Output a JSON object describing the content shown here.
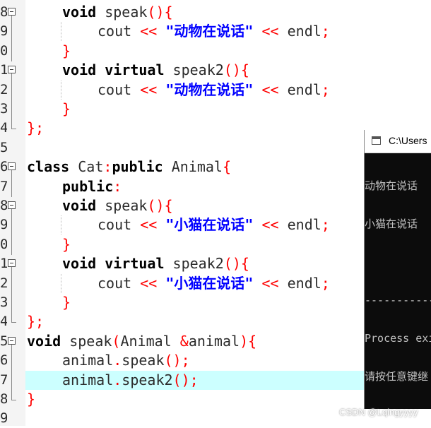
{
  "editor": {
    "lines": [
      {
        "n": "8"
      },
      {
        "n": "9"
      },
      {
        "n": "0"
      },
      {
        "n": "1"
      },
      {
        "n": "2"
      },
      {
        "n": "3"
      },
      {
        "n": "4"
      },
      {
        "n": "5"
      },
      {
        "n": "6"
      },
      {
        "n": "7"
      },
      {
        "n": "8"
      },
      {
        "n": "9"
      },
      {
        "n": "0"
      },
      {
        "n": "1"
      },
      {
        "n": "2"
      },
      {
        "n": "3"
      },
      {
        "n": "4"
      },
      {
        "n": "5"
      },
      {
        "n": "6"
      },
      {
        "n": "7"
      },
      {
        "n": "8"
      },
      {
        "n": "9"
      }
    ],
    "tokens": {
      "void": "void",
      "speak": " speak",
      "parens_brace": "(){",
      "cout": "cout",
      "shl": " << ",
      "shl2": " << ",
      "endl": "endl",
      "semi": ";",
      "str_animal": "\"动物在说话\"",
      "str_cat": "\"小猫在说话\"",
      "close_brace": "}",
      "virtual": " virtual",
      "speak2": " speak2",
      "close_class": "};",
      "class": "class",
      "cat_decl": " Cat",
      "colon": ":",
      "public": "public",
      "animal_type": " Animal",
      "open_brace": "{",
      "public_label": "public",
      "speak_fn": " speak",
      "open_paren": "(",
      "animal_param_type": "Animal ",
      "amp": "&",
      "animal_param": "animal",
      "close_paren_brace": "){",
      "animal_obj": "animal",
      "dot": ".",
      "call_speak": "speak",
      "call_speak2": "speak2",
      "call_parens": "();"
    }
  },
  "console": {
    "title": "C:\\Users",
    "output": [
      "动物在说话",
      "小猫在说话",
      "",
      "------------",
      "Process exi",
      "请按任意键继"
    ]
  },
  "watermark": "CSDN @Lqingyyyy"
}
